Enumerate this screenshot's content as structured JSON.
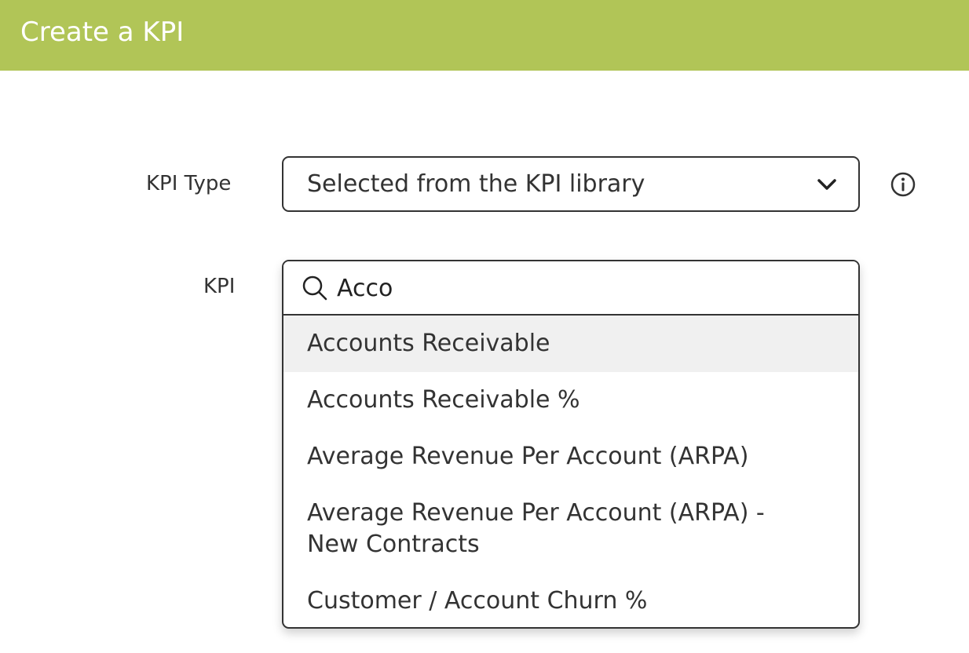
{
  "header": {
    "title": "Create a KPI",
    "background": "#b1c557"
  },
  "form": {
    "kpi_type": {
      "label": "KPI Type",
      "selected_value": "Selected from the KPI library",
      "chevron_icon": "chevron-down-icon",
      "info_icon": "info-icon"
    },
    "kpi": {
      "label": "KPI",
      "search_icon": "search-icon",
      "search_value": "Acco",
      "options": [
        {
          "label": "Accounts Receivable",
          "highlighted": true
        },
        {
          "label": "Accounts Receivable %",
          "highlighted": false
        },
        {
          "label": "Average Revenue Per Account (ARPA)",
          "highlighted": false
        },
        {
          "label": "Average Revenue Per Account (ARPA) - New Contracts",
          "highlighted": false
        },
        {
          "label": "Customer / Account Churn %",
          "highlighted": false
        }
      ]
    }
  },
  "colors": {
    "accent": "#b1c557",
    "border": "#333333",
    "highlight": "#f0f0f0"
  }
}
